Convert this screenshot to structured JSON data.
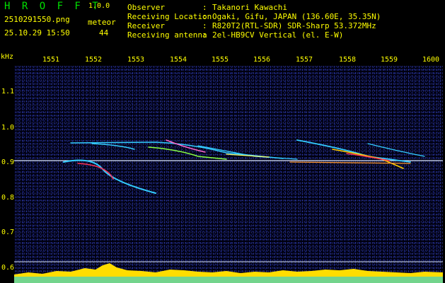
{
  "app": {
    "title": "H R O F F T",
    "version": "1.0.0"
  },
  "file": {
    "name": "2510291550.png",
    "datetime": "25.10.29 15:50"
  },
  "meteor": {
    "label": "meteor",
    "count": "44"
  },
  "info": [
    {
      "key": "Observer",
      "value": "Takanori Kawachi"
    },
    {
      "key": "Receiving Location",
      "value": "Ogaki, Gifu, JAPAN (136.60E, 35.35N)"
    },
    {
      "key": "Receiver",
      "value": "R820T2(RTL-SDR) SDR-Sharp 53.372MHz"
    },
    {
      "key": "Receiving antenna",
      "value": "2el-HB9CV Vertical (el. E-W)"
    }
  ],
  "axis": {
    "y_unit": "kHz",
    "y_ticks": [
      "1.1",
      "1.0",
      "0.9",
      "0.8",
      "0.7",
      "0.6"
    ],
    "x_ticks": [
      "1551",
      "1552",
      "1553",
      "1554",
      "1555",
      "1556",
      "1557",
      "1558",
      "1559",
      "1600"
    ]
  },
  "colors": {
    "label": "#ffff00",
    "title": "#00e000",
    "grid": "#c8d8ff",
    "trail": "#33ccff"
  }
}
